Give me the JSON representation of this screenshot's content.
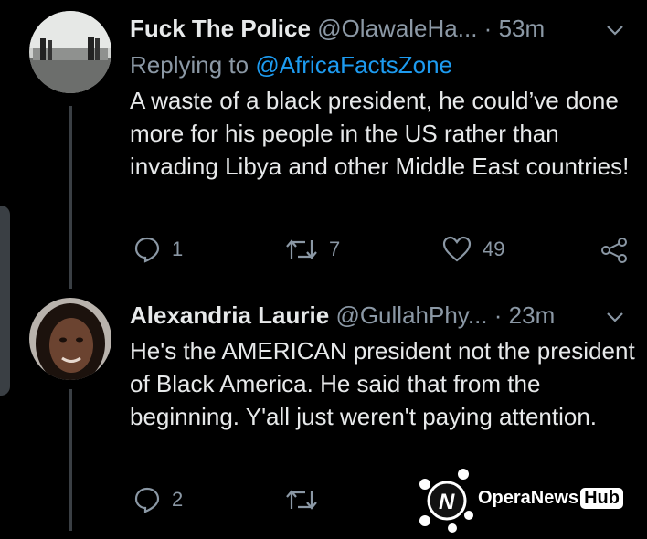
{
  "tweets": [
    {
      "name": "Fuck The Police",
      "handle": "@OlawaleHa...",
      "separator": "·",
      "time": "53m",
      "replying_prefix": "Replying to ",
      "replying_to": "@AfricaFactsZone",
      "text": "A waste of a black president, he could’ve done more for his people in the US rather than invading Libya and other Middle East countries!",
      "replies": "1",
      "retweets": "7",
      "likes": "49"
    },
    {
      "name": "Alexandria Laurie",
      "handle": "@GullahPhy...",
      "separator": "·",
      "time": "23m",
      "text": "He's the AMERICAN president not the president of Black America. He said that from the beginning.  Y'all just weren't paying attention.",
      "replies": "2"
    }
  ],
  "watermark": {
    "brand": "OperaNews",
    "badge": "Hub"
  },
  "colors": {
    "background": "#000000",
    "text": "#e7e9ea",
    "muted": "#8b98a5",
    "link": "#1d9bf0"
  },
  "icons": [
    "reply-icon",
    "retweet-icon",
    "like-icon",
    "share-icon",
    "chevron-down-icon"
  ]
}
